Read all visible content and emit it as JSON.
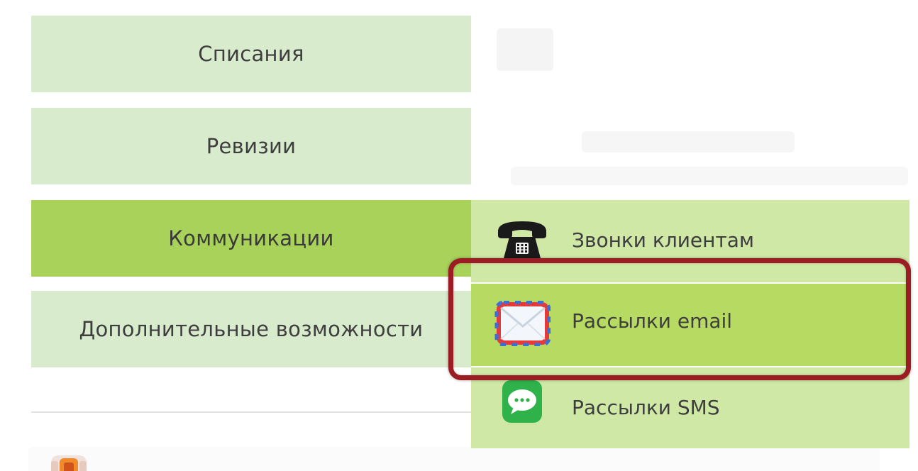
{
  "menu": {
    "items": [
      {
        "label": "Списания",
        "active": false
      },
      {
        "label": "Ревизии",
        "active": false
      },
      {
        "label": "Коммуникации",
        "active": true
      },
      {
        "label": "Дополнительные возможности",
        "active": false
      }
    ]
  },
  "submenu": {
    "items": [
      {
        "label": "Звонки клиентам",
        "icon": "phone-icon"
      },
      {
        "label": "Рассылки email",
        "icon": "envelope-icon",
        "highlighted": true
      },
      {
        "label": "Рассылки SMS",
        "icon": "sms-chat-icon"
      }
    ]
  },
  "colors": {
    "menu_bg": "#d8ebcc",
    "menu_active_bg": "#a8d25a",
    "submenu_bg": "#cfe8a6",
    "submenu_hover_bg": "#b7da62",
    "highlight_border": "#9b1c22"
  }
}
